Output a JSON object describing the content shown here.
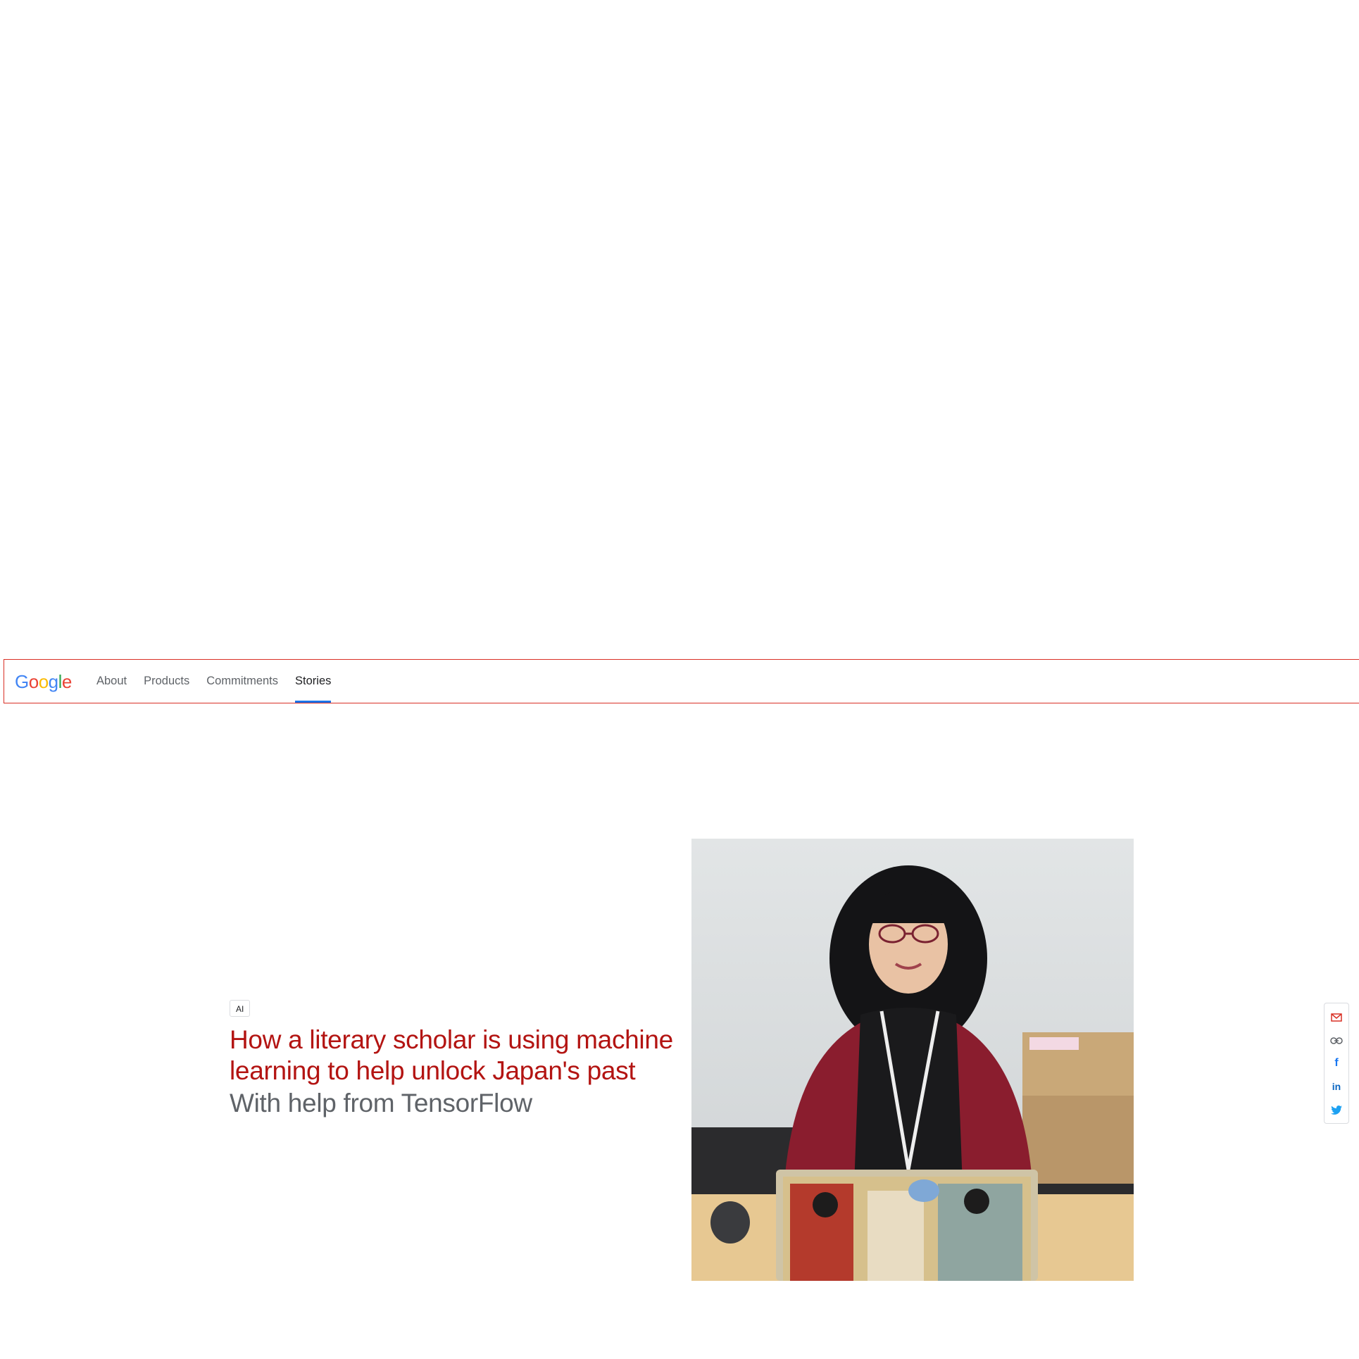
{
  "header": {
    "logo_text": "Google",
    "logo_colors": [
      "#4285F4",
      "#EA4335",
      "#FBBC05",
      "#4285F4",
      "#34A853",
      "#EA4335"
    ],
    "nav": [
      {
        "label": "About",
        "active": false
      },
      {
        "label": "Products",
        "active": false
      },
      {
        "label": "Commitments",
        "active": false
      },
      {
        "label": "Stories",
        "active": true
      }
    ]
  },
  "hero": {
    "tag": "AI",
    "title": "How a literary scholar is using machine learning to help unlock Japan's past",
    "subtitle": "With help from TensorFlow",
    "image_desc": "Portrait of a woman with glasses seated at a desk behind a laptop decorated with Japanese art"
  },
  "share": {
    "items": [
      {
        "icon": "mail-icon",
        "color": "#d93025"
      },
      {
        "icon": "link-icon",
        "color": "#5f6368"
      },
      {
        "icon": "facebook-icon",
        "color": "#1877f2"
      },
      {
        "icon": "linkedin-icon",
        "color": "#0a66c2"
      },
      {
        "icon": "twitter-icon",
        "color": "#1da1f2"
      }
    ]
  },
  "colors": {
    "title_red": "#b31412",
    "subtitle_gray": "#5f6368",
    "nav_active_underline": "#1a73e8"
  }
}
